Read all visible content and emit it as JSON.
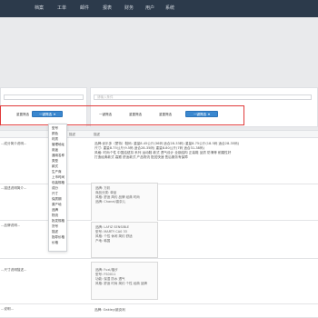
{
  "nav": [
    "档案",
    "工单",
    "邮件",
    "报表",
    "财务",
    "用户",
    "系统"
  ],
  "filters": {
    "left_placeholder": "",
    "right_placeholder": "请输入条件"
  },
  "buttons": {
    "group1": [
      "重置筛选",
      "一键筛选"
    ],
    "group2": [
      "一键筛选",
      "重置筛选",
      "重置筛选",
      "一键筛选"
    ]
  },
  "table": {
    "header_left": "描述",
    "header_right": "描述"
  },
  "dropdown_items": [
    "型号",
    "颜色",
    "材质",
    "管理地址",
    "用途",
    "通用名称",
    "类型",
    "款式",
    "生产商",
    "上市时间",
    "包装规格",
    "成分",
    "尺寸",
    "保质期",
    "原产地",
    "品牌",
    "物流",
    "批发规格",
    "货号",
    "描述",
    "指导价格",
    "价格"
  ],
  "rows": [
    {
      "left": "...成分简介说明...",
      "right": "品牌:优乐多（蒙特）鞋码: 重量8.45公斤(36码 适合28-33码) 重量8.75公斤(18.5码 适合28-35码)\n尺寸: 重量8.75公斤(9.5码 适合28-35码) 重量8.80公斤(7码 适合31-38码)\n风格: 时尚个性 中国结纽扣 系列 运动鞋 款式 透气设计 全钢结构 正装鞋 品质 防滑等 耐磨性好\n打造经典款式 高跟 舒适款式 产品物流 配送快速 售后服务有保障",
      "cards": []
    },
    {
      "left": "...描述说明简介...",
      "right": "",
      "cards": [
        "品牌: 万彩",
        "商品分类: 单品",
        "风格: 舒适 简约 品牌 经典 时尚",
        "品牌: Chanel/香奈儿"
      ]
    },
    {
      "left": "...品牌说明...",
      "right": "",
      "cards": [
        "品牌: LAFIZ SENSIBLE",
        "型号: MARTY CA0 33",
        "风格: 个性 休闲 简约 舒适",
        "产地: 韩国"
      ]
    },
    {
      "left": "...尺寸说明描述...",
      "right": "",
      "cards": [
        "品牌: Fuxi/福汐",
        "型号: FS0011",
        "功能: 保湿 防水 透气",
        "风格: 舒适 时尚 简约 个性 经典 品牌"
      ]
    },
    {
      "left": "...说明...",
      "right": "品牌: Oakley/欧克利",
      "cards": []
    }
  ]
}
